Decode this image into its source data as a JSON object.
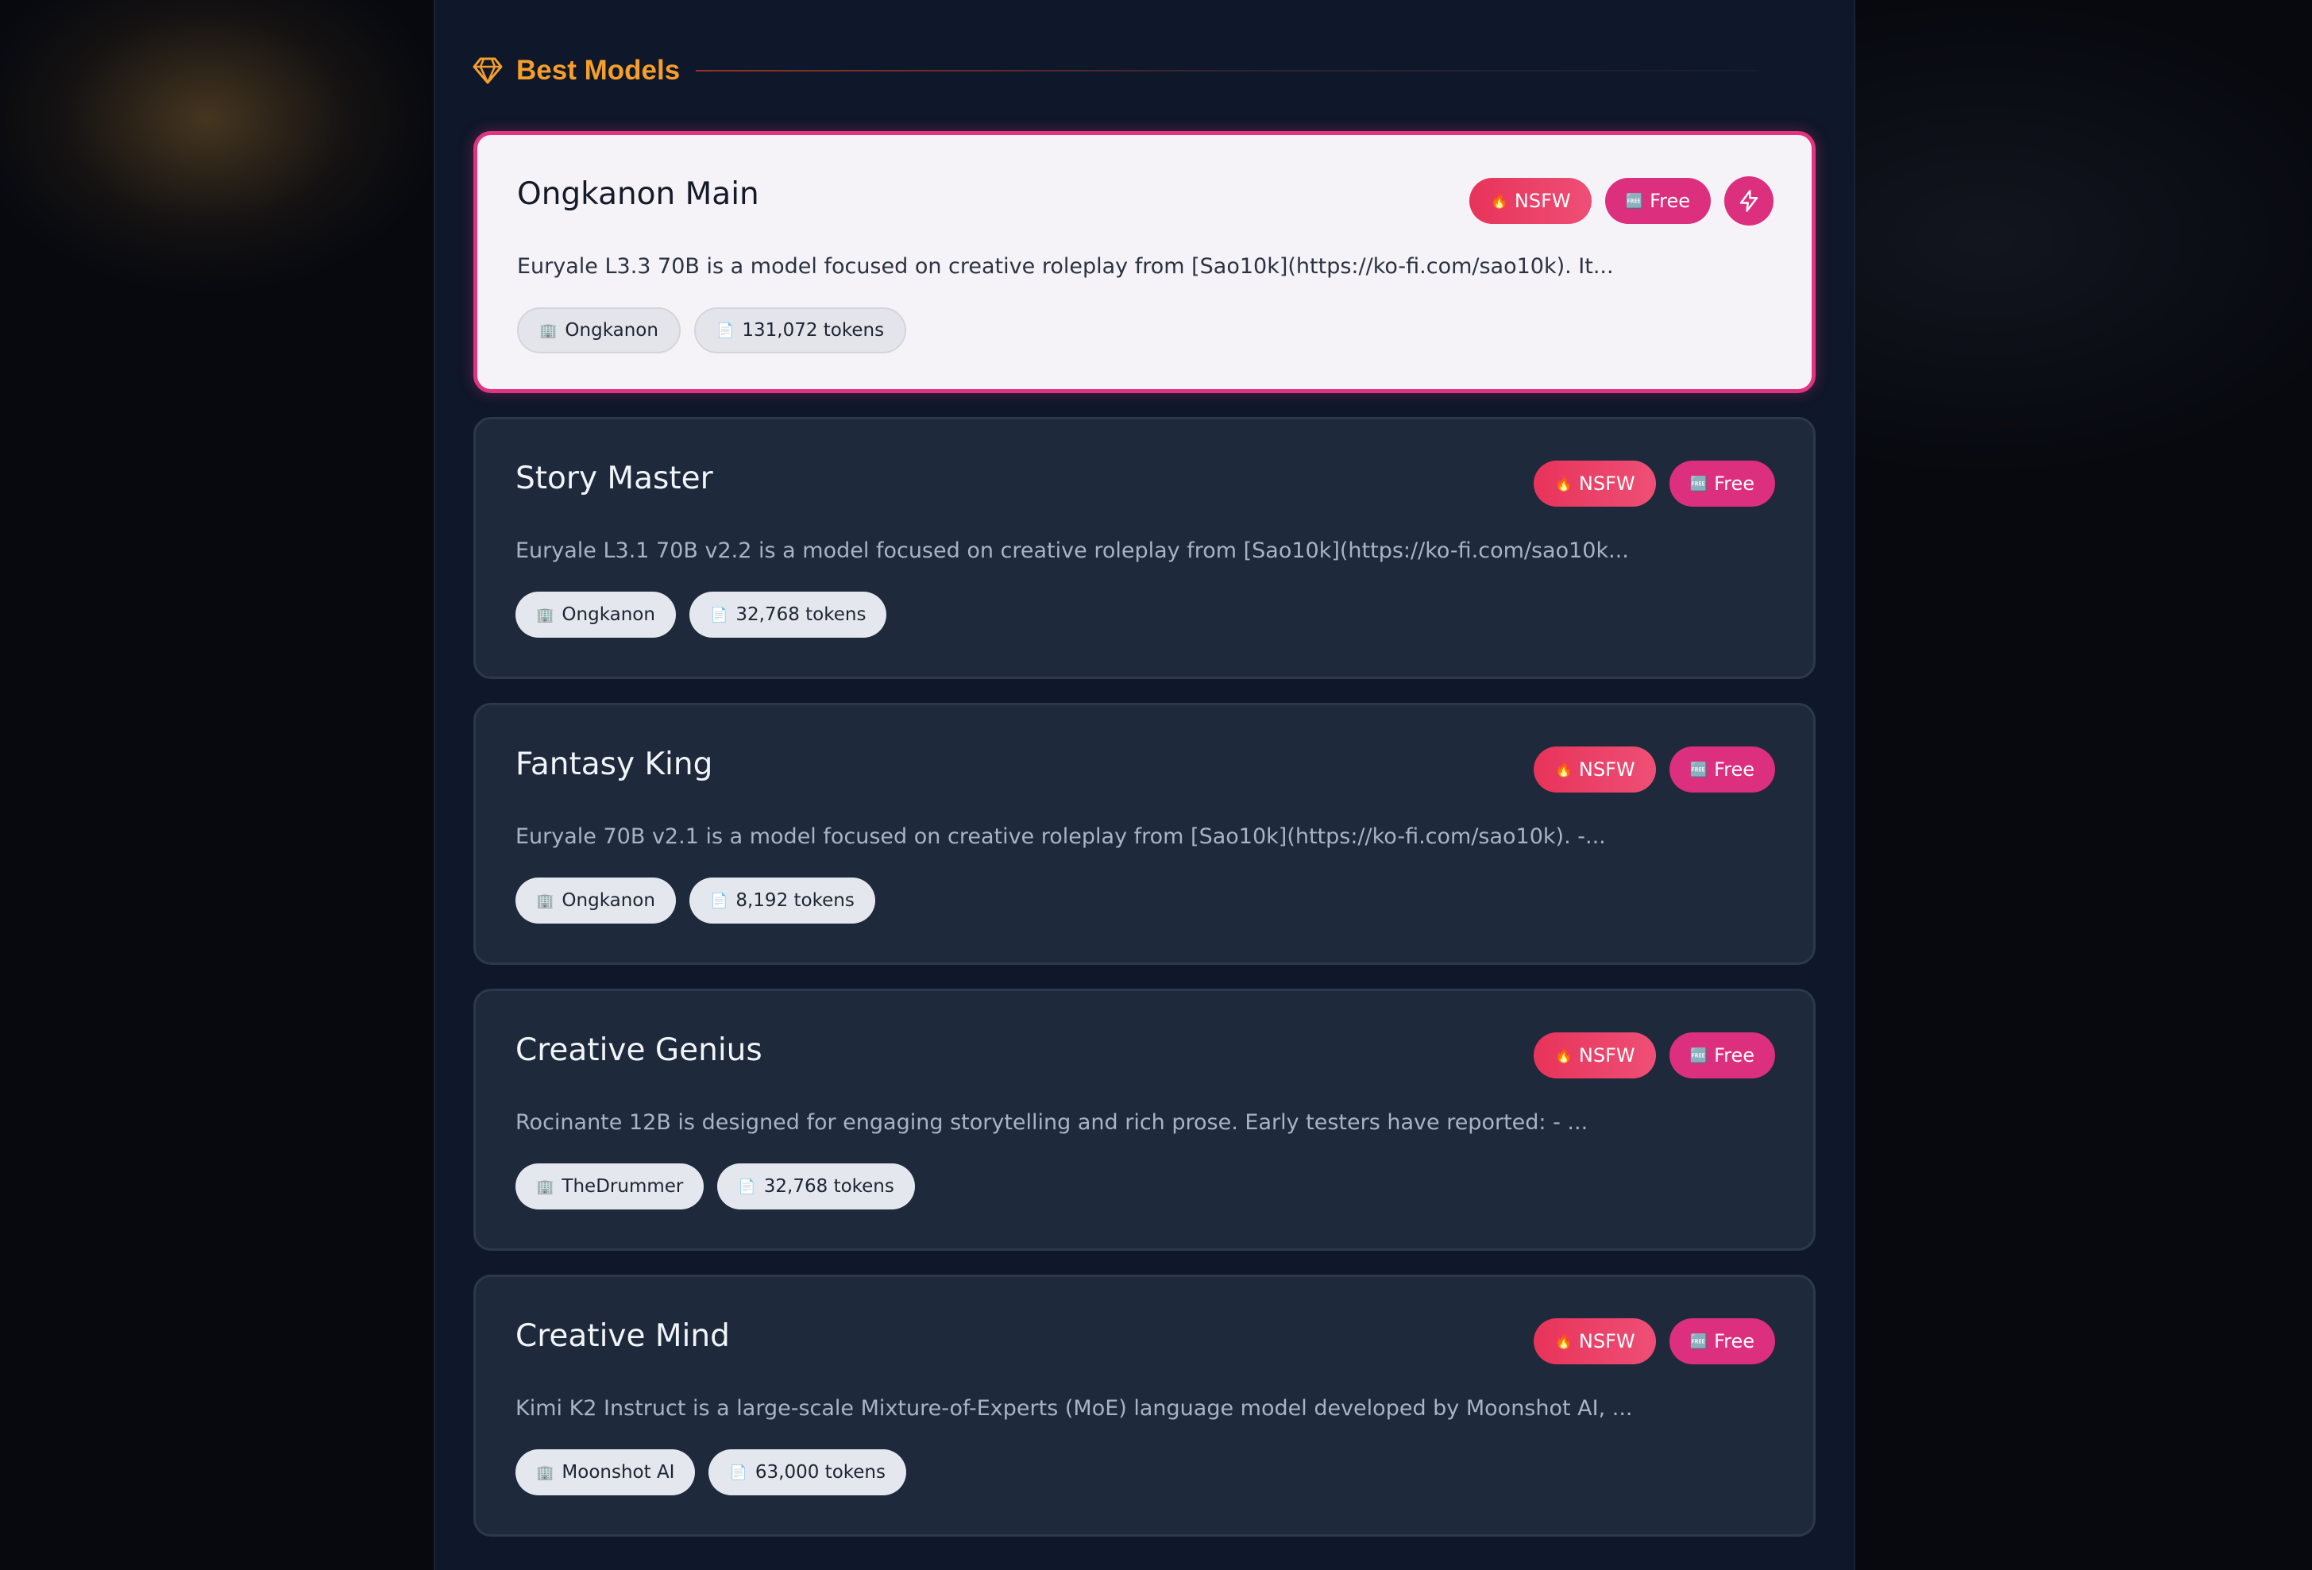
{
  "section": {
    "title": "Best Models",
    "icon": "gem-icon",
    "accent_color": "#f59e2b"
  },
  "badges": {
    "nsfw_label": "NSFW",
    "free_label": "Free",
    "nsfw_icon": "fire-icon",
    "free_icon": "free-icon"
  },
  "models": [
    {
      "title": "Ongkanon Main",
      "description": "Euryale L3.3 70B is a model focused on creative roleplay from [Sao10k](https://ko-fi.com/sao10k). It...",
      "provider": "Ongkanon",
      "tokens": "131,072 tokens",
      "selected": true
    },
    {
      "title": "Story Master",
      "description": "Euryale L3.1 70B v2.2 is a model focused on creative roleplay from [Sao10k](https://ko-fi.com/sao10k...",
      "provider": "Ongkanon",
      "tokens": "32,768 tokens",
      "selected": false
    },
    {
      "title": "Fantasy King",
      "description": "Euryale 70B v2.1 is a model focused on creative roleplay from [Sao10k](https://ko-fi.com/sao10k). -...",
      "provider": "Ongkanon",
      "tokens": "8,192 tokens",
      "selected": false
    },
    {
      "title": "Creative Genius",
      "description": "Rocinante 12B is designed for engaging storytelling and rich prose. Early testers have reported: - ...",
      "provider": "TheDrummer",
      "tokens": "32,768 tokens",
      "selected": false
    },
    {
      "title": "Creative Mind",
      "description": "Kimi K2 Instruct is a large-scale Mixture-of-Experts (MoE) language model developed by Moonshot AI, ...",
      "provider": "Moonshot AI",
      "tokens": "63,000 tokens",
      "selected": false
    }
  ],
  "colors": {
    "panel_bg": "#0f172a",
    "card_bg": "#1e293b",
    "selected_border": "#e0347f",
    "badge_free": "#dc2f7e",
    "badge_nsfw": "#e8335a"
  }
}
